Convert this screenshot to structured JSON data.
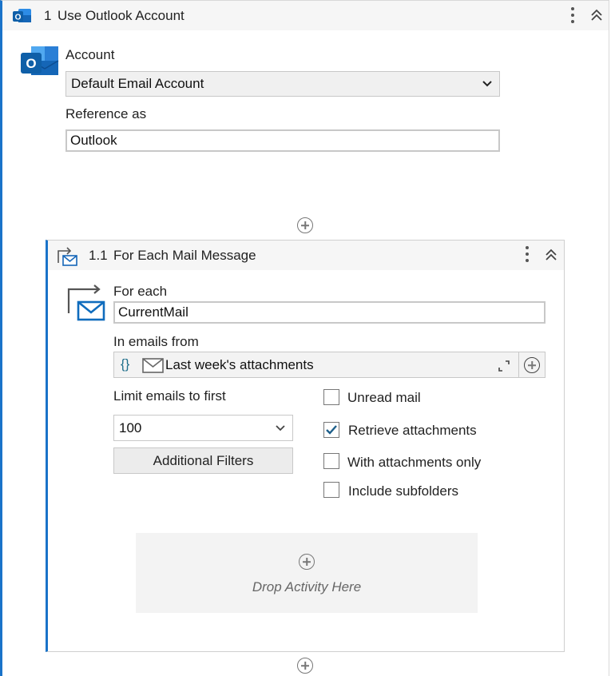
{
  "activity": {
    "number": "1",
    "title": "Use Outlook Account",
    "account_label": "Account",
    "account_value": "Default Email Account",
    "reference_label": "Reference as",
    "reference_value": "Outlook"
  },
  "child": {
    "number": "1.1",
    "title": "For Each Mail Message",
    "for_each_label": "For each",
    "for_each_value": "CurrentMail",
    "in_emails_label": "In emails from",
    "in_emails_value": "Last week's attachments",
    "limit_label": "Limit emails to first",
    "limit_value": "100",
    "filters_button": "Additional Filters",
    "options": [
      {
        "label": "Unread mail",
        "checked": false
      },
      {
        "label": "Retrieve attachments",
        "checked": true
      },
      {
        "label": "With attachments only",
        "checked": false
      },
      {
        "label": "Include subfolders",
        "checked": false
      }
    ],
    "drop_text": "Drop Activity Here"
  },
  "colors": {
    "accent": "#1a73c9",
    "outlook_blue": "#0f6cbd",
    "check": "#1d5f8a"
  }
}
